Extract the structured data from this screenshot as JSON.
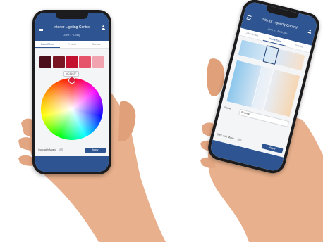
{
  "colors": {
    "brand_blue": "#2e5591",
    "swatch_1": "#4a0f1a",
    "swatch_2": "#7a1524",
    "swatch_3": "#c4102f",
    "swatch_4": "#e6546b",
    "swatch_5": "#f1a3b0",
    "wheel_handle": "#d1213b"
  },
  "left_phone": {
    "header": {
      "title": "Interior Lighting Control",
      "subtitle": "Zone 1 · Living",
      "menu_icon": "menu-icon",
      "user_icon": "user-icon"
    },
    "tabs": [
      {
        "label": "Color Wheel"
      },
      {
        "label": "Presets"
      },
      {
        "label": "Scenes"
      }
    ],
    "hex_value": "#C4102F",
    "bottom": {
      "label": "Sync with Music",
      "button_label": "Apply"
    }
  },
  "right_phone": {
    "header": {
      "title": "Interior Lighting Control",
      "subtitle": "Zone 2 · Bedroom",
      "menu_icon": "menu-icon",
      "user_icon": "user-icon"
    },
    "tabs": [
      {
        "label": "Color Wheel"
      },
      {
        "label": "White Tone"
      },
      {
        "label": "Scenes"
      }
    ],
    "field": {
      "label": "Name",
      "value": "Evening"
    },
    "bottom": {
      "label": "Sync with Music",
      "button_label": "Apply"
    }
  }
}
